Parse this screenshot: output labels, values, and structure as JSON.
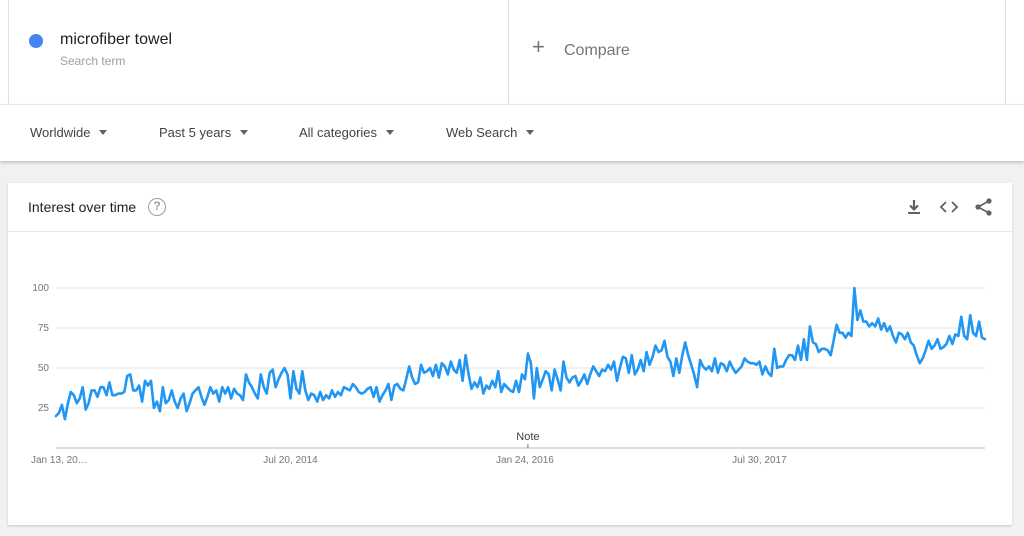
{
  "search_term": {
    "label": "microfiber towel",
    "sublabel": "Search term",
    "color": "#4285f4"
  },
  "compare": {
    "label": "Compare"
  },
  "filters": [
    {
      "label": "Worldwide"
    },
    {
      "label": "Past 5 years"
    },
    {
      "label": "All categories"
    },
    {
      "label": "Web Search"
    }
  ],
  "card": {
    "title": "Interest over time",
    "icons": [
      "help-icon",
      "download-icon",
      "embed-icon",
      "share-icon"
    ]
  },
  "chart_data": {
    "type": "line",
    "title": "",
    "xlabel": "",
    "ylabel": "",
    "y_ticks": [
      "25",
      "50",
      "75",
      "100"
    ],
    "x_ticks": [
      "Jan 13, 20…",
      "Jul 20, 2014",
      "Jan 24, 2016",
      "Jul 30, 2017"
    ],
    "ylim": [
      0,
      100
    ],
    "grid": true,
    "note": "Note",
    "series": [
      {
        "color": "#2196f3",
        "values": [
          20,
          22,
          27,
          18,
          28,
          35,
          33,
          28,
          31,
          38,
          24,
          28,
          36,
          36,
          32,
          38,
          38,
          33,
          41,
          33,
          33,
          34,
          34,
          35,
          45,
          46,
          36,
          36,
          39,
          29,
          42,
          39,
          42,
          25,
          29,
          23,
          38,
          28,
          30,
          36,
          29,
          25,
          31,
          34,
          23,
          28,
          34,
          36,
          38,
          32,
          27,
          32,
          38,
          34,
          36,
          29,
          38,
          34,
          38,
          31,
          37,
          34,
          33,
          30,
          46,
          41,
          38,
          34,
          31,
          46,
          38,
          34,
          47,
          49,
          38,
          43,
          47,
          50,
          46,
          31,
          48,
          37,
          34,
          48,
          36,
          30,
          34,
          33,
          29,
          35,
          30,
          33,
          31,
          36,
          32,
          35,
          33,
          38,
          37,
          36,
          40,
          38,
          35,
          34,
          35,
          37,
          38,
          32,
          38,
          29,
          33,
          36,
          40,
          30,
          39,
          40,
          37,
          36,
          43,
          51,
          44,
          40,
          41,
          52,
          47,
          48,
          50,
          45,
          52,
          44,
          53,
          51,
          46,
          54,
          49,
          47,
          55,
          42,
          58,
          46,
          37,
          41,
          38,
          44,
          34,
          39,
          37,
          42,
          38,
          48,
          35,
          40,
          38,
          36,
          35,
          42,
          35,
          46,
          43,
          59,
          53,
          31,
          50,
          38,
          43,
          48,
          46,
          36,
          49,
          43,
          36,
          54,
          44,
          41,
          44,
          45,
          39,
          42,
          46,
          40,
          46,
          51,
          48,
          45,
          49,
          48,
          52,
          49,
          54,
          42,
          50,
          57,
          56,
          47,
          58,
          46,
          49,
          55,
          48,
          60,
          52,
          57,
          64,
          60,
          61,
          67,
          57,
          54,
          45,
          56,
          47,
          58,
          66,
          58,
          52,
          46,
          38,
          55,
          51,
          49,
          51,
          48,
          56,
          47,
          53,
          52,
          48,
          54,
          50,
          47,
          49,
          51,
          56,
          54,
          53,
          53,
          52,
          54,
          46,
          51,
          47,
          45,
          62,
          50,
          51,
          51,
          55,
          58,
          58,
          55,
          64,
          55,
          68,
          55,
          76,
          66,
          65,
          60,
          62,
          62,
          61,
          58,
          67,
          77,
          72,
          72,
          69,
          72,
          70,
          100,
          80,
          86,
          79,
          79,
          76,
          78,
          76,
          81,
          74,
          78,
          73,
          76,
          70,
          66,
          72,
          71,
          68,
          72,
          66,
          64,
          58,
          53,
          56,
          61,
          67,
          62,
          64,
          68,
          62,
          63,
          65,
          70,
          65,
          71,
          70,
          82,
          70,
          68,
          83,
          72,
          70,
          79,
          69,
          68
        ]
      }
    ]
  }
}
